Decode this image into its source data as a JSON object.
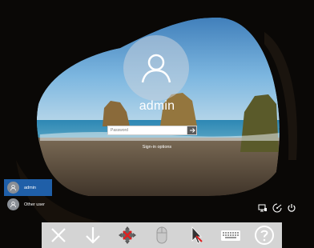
{
  "login": {
    "username": "admin",
    "password_placeholder": "Password",
    "signin_options_label": "Sign-in options"
  },
  "user_list": {
    "items": [
      {
        "label": "admin",
        "selected": true
      },
      {
        "label": "Other user",
        "selected": false
      }
    ]
  },
  "system_icons": [
    "network-icon",
    "accessibility-icon",
    "power-icon"
  ],
  "toolbar": {
    "buttons": [
      "close-icon",
      "arrow-down-icon",
      "move-icon",
      "mouse-icon",
      "pointer-icon",
      "keyboard-icon",
      "help-icon"
    ]
  },
  "colors": {
    "selected_user_bg": "#1f5fa8",
    "toolbar_bg": "#d4d4d4",
    "sea": "#3b8fb8",
    "sky": "#6fb0de"
  }
}
